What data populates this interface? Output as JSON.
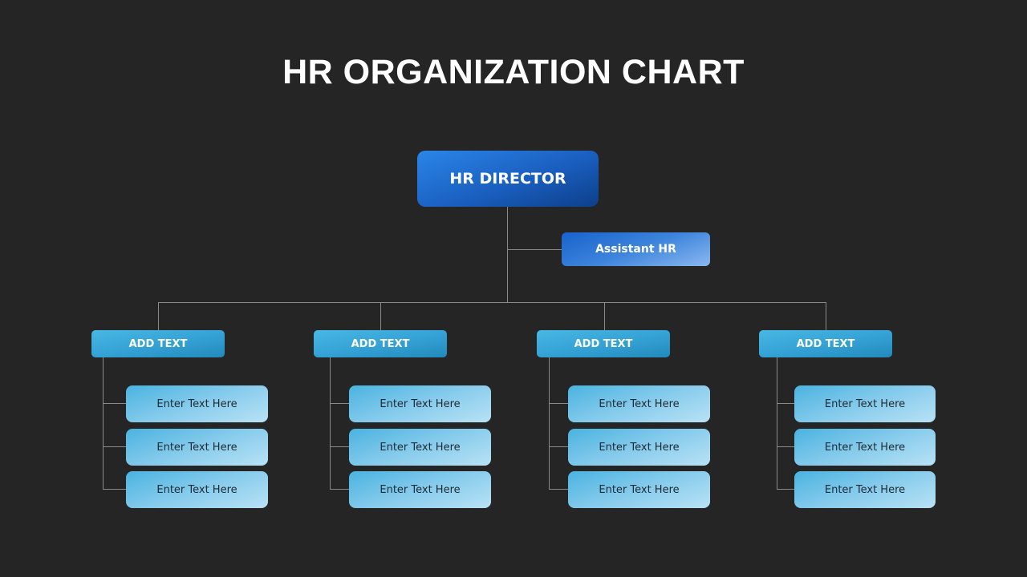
{
  "title": "HR ORGANIZATION CHART",
  "director": {
    "label": "HR DIRECTOR"
  },
  "assistant": {
    "label": "Assistant HR"
  },
  "departments": [
    {
      "label": "ADD TEXT",
      "items": [
        "Enter Text Here",
        "Enter Text Here",
        "Enter Text Here"
      ]
    },
    {
      "label": "ADD TEXT",
      "items": [
        "Enter Text Here",
        "Enter Text Here",
        "Enter Text Here"
      ]
    },
    {
      "label": "ADD TEXT",
      "items": [
        "Enter Text Here",
        "Enter Text Here",
        "Enter Text Here"
      ]
    },
    {
      "label": "ADD TEXT",
      "items": [
        "Enter Text Here",
        "Enter Text Here",
        "Enter Text Here"
      ]
    }
  ],
  "colors": {
    "background": "#252525",
    "director": "#1a5fc0",
    "assistant": "#3d84dc",
    "department": "#35a3d6",
    "item": "#86cbec",
    "connector": "#8a8a8a"
  }
}
